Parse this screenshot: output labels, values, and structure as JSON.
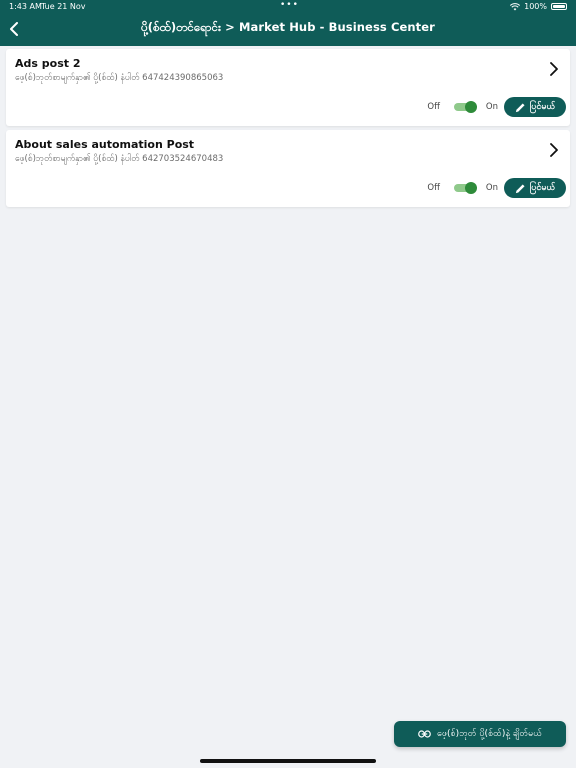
{
  "status_bar": {
    "time": "1:43 AM",
    "date": "Tue 21 Nov",
    "dots": "•••",
    "battery_percent": "100%"
  },
  "header": {
    "title": "ပို့(စ်ထ်)တင်ရောင်း > Market Hub - Business Center",
    "back_icon": "chevron-left-icon",
    "background": "#0f5c58"
  },
  "posts": [
    {
      "title": "Ads post 2",
      "subtitle": "ဖေ့(စ်)ဘုတ်စာမျက်နှာ၏ ပို့(စ်ထ်) နံပါတ် 647424390865063",
      "off_label": "Off",
      "on_label": "On",
      "toggle_on": true,
      "edit_label": "ပြင်မယ်"
    },
    {
      "title": "About sales automation Post",
      "subtitle": "ဖေ့(စ်)ဘုတ်စာမျက်နှာ၏ ပို့(စ်ထ်) နံပါတ် 642703524670483",
      "off_label": "Off",
      "on_label": "On",
      "toggle_on": true,
      "edit_label": "ပြင်မယ်"
    }
  ],
  "fab": {
    "label": "ဖေ့(စ်)ဘုတ် ပို့(စ်ထ်)နဲ့ ချိတ်မယ်",
    "icon": "link-icon"
  },
  "colors": {
    "primary": "#0f5c58",
    "toggle_track": "#8fc98b",
    "toggle_knob": "#2e8b3a",
    "background": "#f0f2f5"
  }
}
